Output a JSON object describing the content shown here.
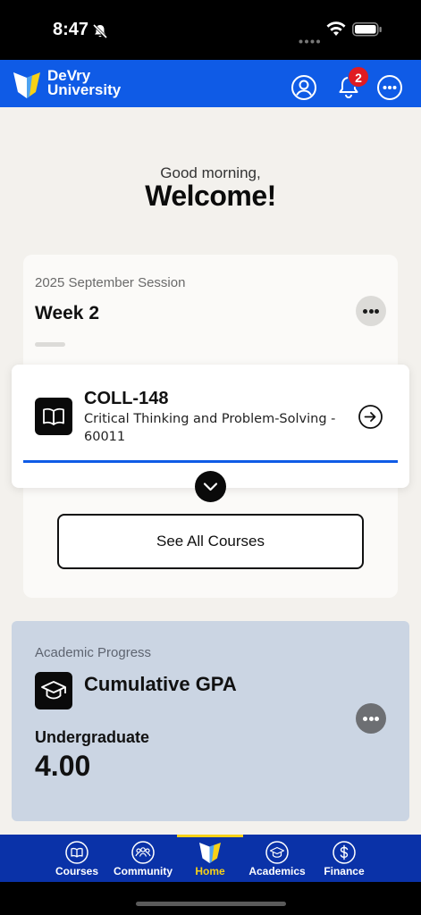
{
  "status_bar": {
    "time": "8:47"
  },
  "header": {
    "brand_line1": "DeVry",
    "brand_line2": "University",
    "notification_count": "2"
  },
  "greeting": {
    "subtitle": "Good morning,",
    "title": "Welcome!"
  },
  "session_card": {
    "session_label": "2025 September Session",
    "week_label": "Week 2",
    "course": {
      "code": "COLL-148",
      "name": "Critical Thinking and Problem-Solving - 60011",
      "progress": 1.0
    },
    "see_all_label": "See All Courses"
  },
  "academic_card": {
    "section_label": "Academic Progress",
    "title": "Cumulative GPA",
    "level": "Undergraduate",
    "gpa": "4.00"
  },
  "bottom_nav": {
    "items": [
      {
        "label": "Courses",
        "icon": "book-icon"
      },
      {
        "label": "Community",
        "icon": "people-icon"
      },
      {
        "label": "Home",
        "icon": "devry-shield-icon",
        "active": true
      },
      {
        "label": "Academics",
        "icon": "graduation-cap-icon"
      },
      {
        "label": "Finance",
        "icon": "dollar-icon"
      }
    ]
  },
  "colors": {
    "brand_blue": "#0f5be6",
    "nav_blue": "#0a32a8",
    "accent_yellow": "#f7d117",
    "badge_red": "#e01b22",
    "academic_card_bg": "#cbd5e3"
  }
}
